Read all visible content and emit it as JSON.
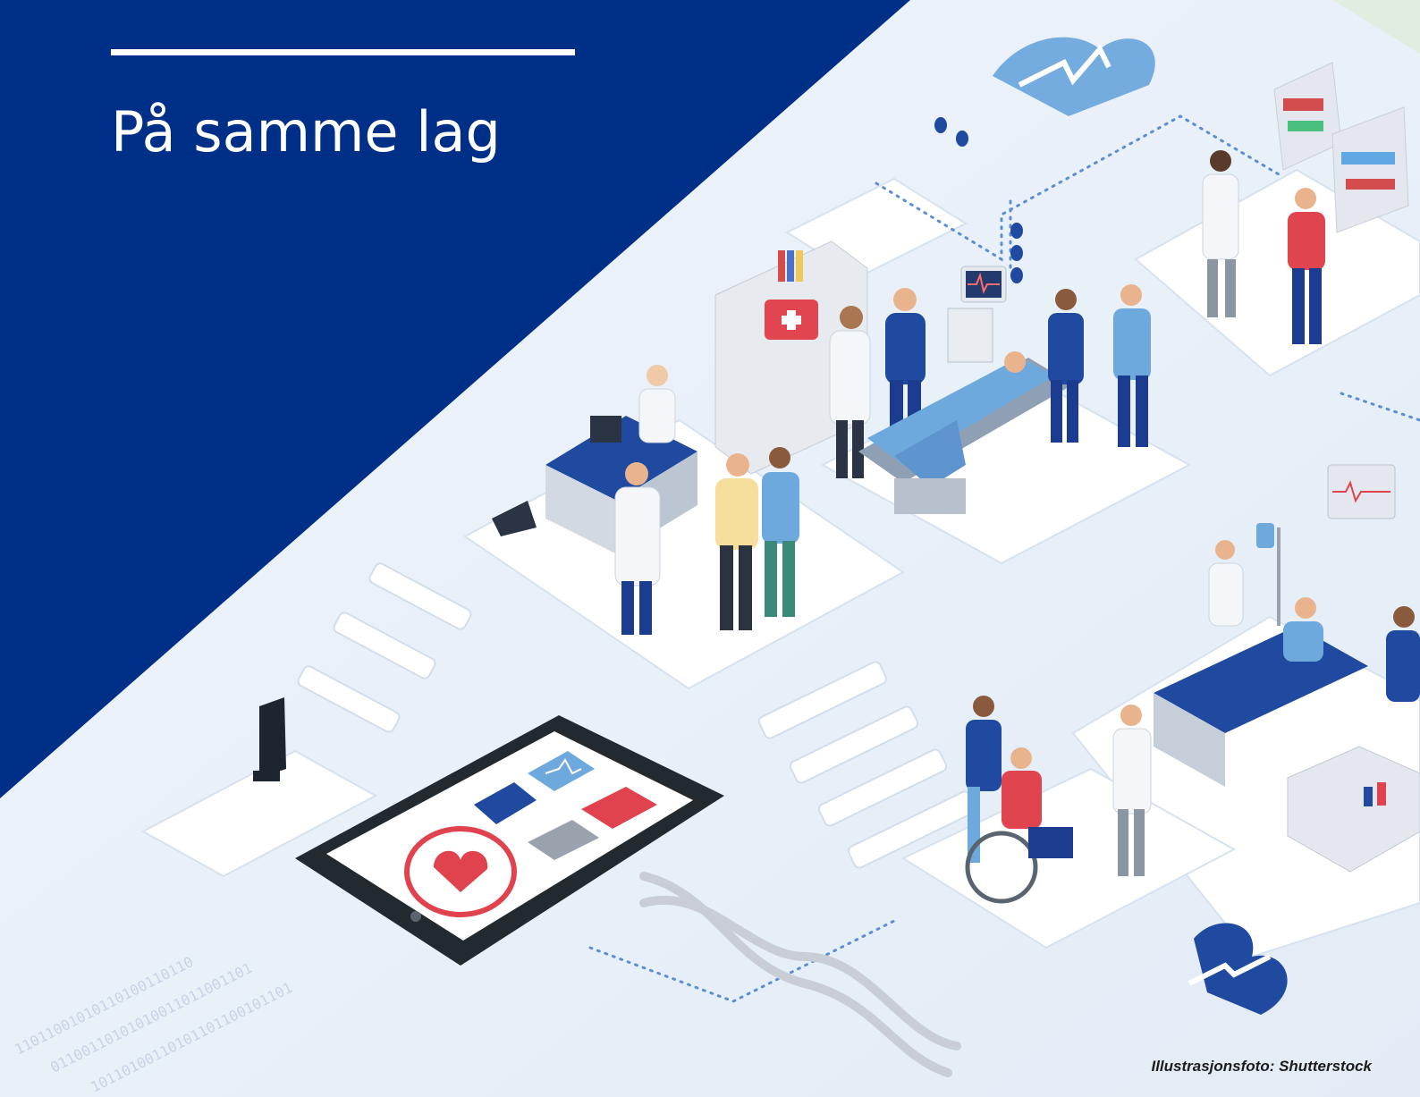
{
  "cover": {
    "title": "På samme lag",
    "photo_credit": "Illustrasjonsfoto: Shutterstock"
  },
  "colors": {
    "navy_panel": "#002f87",
    "illustration_bg": "#e9f0f8",
    "tile": "#ffffff",
    "accent_blue": "#2a4fa3",
    "alert_red": "#e0434d",
    "light_blue": "#6ea9dd"
  },
  "tablet_icons": [
    "heart-pulse-icon",
    "dna-icon",
    "ecg-icon",
    "alarm-icon",
    "document-icon"
  ]
}
